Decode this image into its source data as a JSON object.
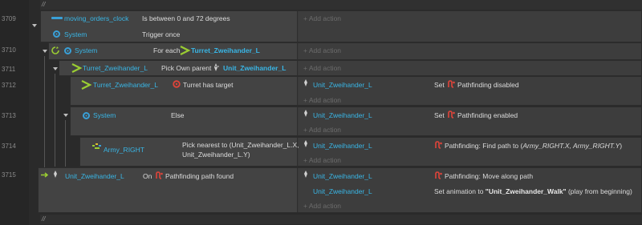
{
  "comments": [
    "//",
    "//"
  ],
  "lines": [
    "3709",
    "3710",
    "3711",
    "3712",
    "3713",
    "3714",
    "3715"
  ],
  "add_action": "Add action",
  "ev3709": {
    "c1_obj": "moving_orders_clock",
    "c1_text": "Is between 0 and 72 degrees",
    "c2_obj": "System",
    "c2_text": "Trigger once"
  },
  "ev3710": {
    "obj": "System",
    "text": "For each",
    "param": "Turret_Zweihander_L"
  },
  "ev3711": {
    "obj": "Turret_Zweihander_L",
    "text": "Pick Own parent",
    "param": "Unit_Zweihander_L"
  },
  "ev3712": {
    "obj": "Turret_Zweihander_L",
    "text": "Turret has target",
    "a_obj": "Unit_Zweihander_L",
    "a_text": "Set",
    "a_param": "Pathfinding disabled"
  },
  "ev3713": {
    "obj": "System",
    "text": "Else",
    "a_obj": "Unit_Zweihander_L",
    "a_text": "Set",
    "a_param": "Pathfinding enabled"
  },
  "ev3714": {
    "obj": "Army_RIGHT",
    "text1": "Pick nearest to (Unit_Zweihander_L.X,",
    "text2": "Unit_Zweihander_L.Y)",
    "a_obj": "Unit_Zweihander_L",
    "a_text": "Pathfinding: Find path to (",
    "a_param": "Army_RIGHT.X, Army_RIGHT.Y",
    "a_end": ")"
  },
  "ev3715": {
    "obj": "Unit_Zweihander_L",
    "text": "On",
    "param": "Pathfinding path found",
    "a1_obj": "Unit_Zweihander_L",
    "a1_text": "Pathfinding: Move along path",
    "a2_obj": "Unit_Zweihander_L",
    "a2_pre": "Set animation to ",
    "a2_val": "\"Unit_Zweihander_Walk\"",
    "a2_post": " (play from beginning)"
  },
  "colors": {
    "object": "#39b6e6",
    "pathfinding": "#e0443a",
    "tree": "#9acd32",
    "gear": "#39a0d8"
  }
}
